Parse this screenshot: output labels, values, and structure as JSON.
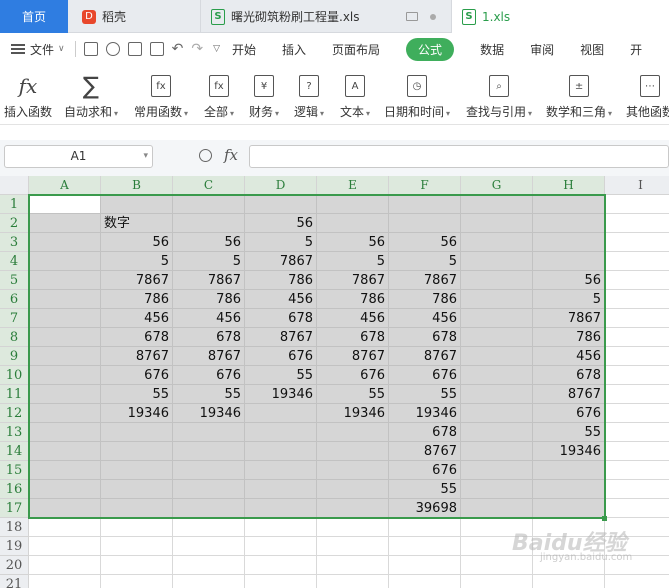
{
  "tabs": {
    "home": "首页",
    "doc": "稻壳",
    "file1": "曙光砌筑粉刷工程量.xls",
    "file2": "1.xls"
  },
  "menu": {
    "file": "文件",
    "tabs": [
      "开始",
      "插入",
      "页面布局",
      "公式",
      "数据",
      "审阅",
      "视图",
      "开"
    ],
    "active_tab": "公式"
  },
  "ribbon": [
    {
      "label": "插入函数",
      "icon": "fx-icon",
      "glyph": "fx"
    },
    {
      "label": "自动求和",
      "icon": "sigma-icon",
      "glyph": "∑"
    },
    {
      "label": "常用函数",
      "icon": "fx-star-icon",
      "glyph": "fx"
    },
    {
      "label": "全部",
      "icon": "fx-box-icon",
      "glyph": "fx"
    },
    {
      "label": "财务",
      "icon": "finance-icon",
      "glyph": "¥"
    },
    {
      "label": "逻辑",
      "icon": "logic-icon",
      "glyph": "?"
    },
    {
      "label": "文本",
      "icon": "text-icon",
      "glyph": "A"
    },
    {
      "label": "日期和时间",
      "icon": "clock-icon",
      "glyph": "◷"
    },
    {
      "label": "查找与引用",
      "icon": "lookup-icon",
      "glyph": "⌕"
    },
    {
      "label": "数学和三角",
      "icon": "math-icon",
      "glyph": "±"
    },
    {
      "label": "其他函数",
      "icon": "more-functions-icon",
      "glyph": "⋯"
    }
  ],
  "formula_bar": {
    "name_box": "A1",
    "fx": "fx",
    "value": ""
  },
  "columns": [
    "A",
    "B",
    "C",
    "D",
    "E",
    "F",
    "G",
    "H",
    "I"
  ],
  "rows": [
    "1",
    "2",
    "3",
    "4",
    "5",
    "6",
    "7",
    "8",
    "9",
    "10",
    "11",
    "12",
    "13",
    "14",
    "15",
    "16",
    "17",
    "18",
    "19",
    "20",
    "21"
  ],
  "cells": {
    "2": {
      "B": "数字",
      "D": "56"
    },
    "3": {
      "B": "56",
      "C": "56",
      "D": "5",
      "E": "56",
      "F": "56"
    },
    "4": {
      "B": "5",
      "C": "5",
      "D": "7867",
      "E": "5",
      "F": "5"
    },
    "5": {
      "B": "7867",
      "C": "7867",
      "D": "786",
      "E": "7867",
      "F": "7867",
      "H": "56"
    },
    "6": {
      "B": "786",
      "C": "786",
      "D": "456",
      "E": "786",
      "F": "786",
      "H": "5"
    },
    "7": {
      "B": "456",
      "C": "456",
      "D": "678",
      "E": "456",
      "F": "456",
      "H": "7867"
    },
    "8": {
      "B": "678",
      "C": "678",
      "D": "8767",
      "E": "678",
      "F": "678",
      "H": "786"
    },
    "9": {
      "B": "8767",
      "C": "8767",
      "D": "676",
      "E": "8767",
      "F": "8767",
      "H": "456"
    },
    "10": {
      "B": "676",
      "C": "676",
      "D": "55",
      "E": "676",
      "F": "676",
      "H": "678"
    },
    "11": {
      "B": "55",
      "C": "55",
      "D": "19346",
      "E": "55",
      "F": "55",
      "H": "8767"
    },
    "12": {
      "B": "19346",
      "C": "19346",
      "E": "19346",
      "F": "19346",
      "H": "676"
    },
    "13": {
      "F": "678",
      "H": "55"
    },
    "14": {
      "F": "8767",
      "H": "19346"
    },
    "15": {
      "F": "676"
    },
    "16": {
      "F": "55"
    },
    "17": {
      "F": "39698"
    }
  },
  "selection": {
    "range": "A1:H17",
    "active": "A1"
  },
  "watermark": {
    "brand": "Baidu经验",
    "sub": "jingyan.baidu.com"
  },
  "colors": {
    "accent": "#3fae5c",
    "home_tab": "#2f7de1",
    "selection_border": "#3a9a4c"
  }
}
